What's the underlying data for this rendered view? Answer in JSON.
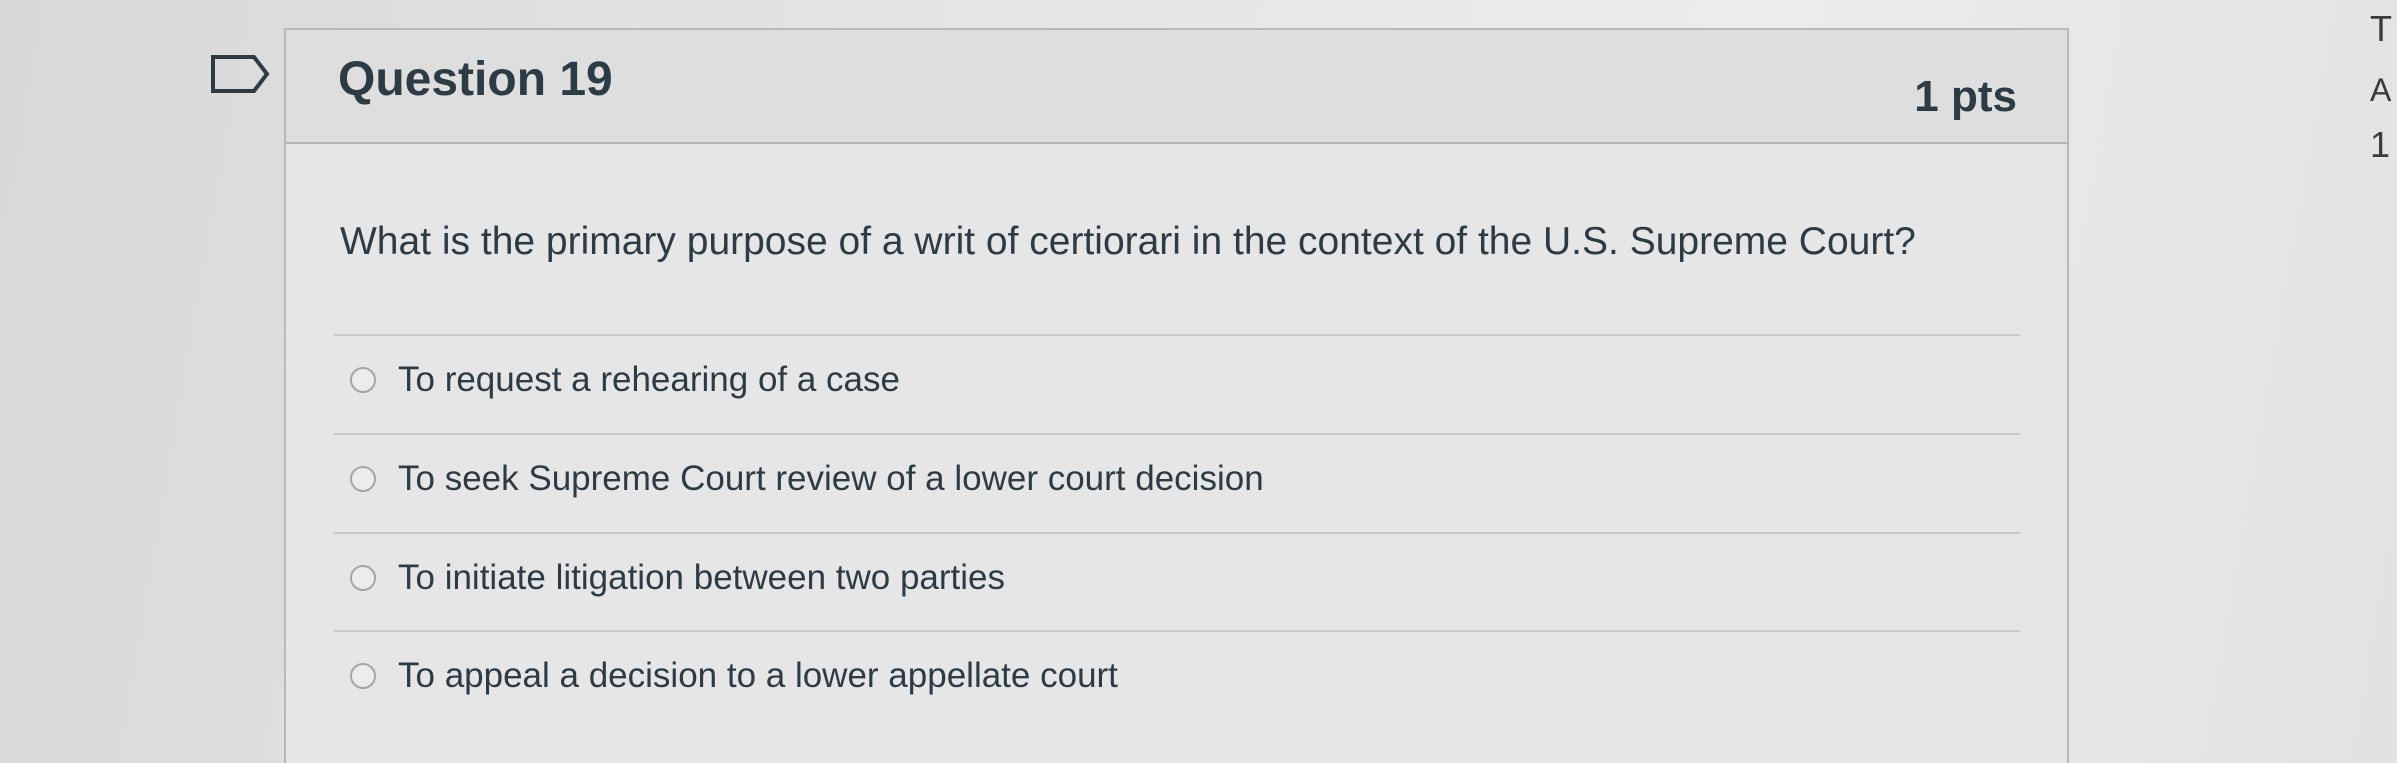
{
  "question": {
    "title": "Question 19",
    "points": "1 pts",
    "text": "What is the primary purpose of a writ of certiorari in the context of the U.S. Supreme Court?",
    "answers": [
      {
        "label": "To request a rehearing of a case",
        "selected": false
      },
      {
        "label": "To seek Supreme Court review of a lower court decision",
        "selected": false
      },
      {
        "label": "To initiate litigation between two parties",
        "selected": false
      },
      {
        "label": "To appeal a decision to a lower appellate court",
        "selected": false
      }
    ]
  },
  "sidebar": {
    "line1": "T",
    "line2": "A",
    "line3": "1"
  },
  "icons": {
    "flag": "flag-icon",
    "radio": "radio-icon"
  },
  "colors": {
    "text": "#2d3b45",
    "header_bg": "#dedede",
    "border": "#b9b9b9"
  }
}
